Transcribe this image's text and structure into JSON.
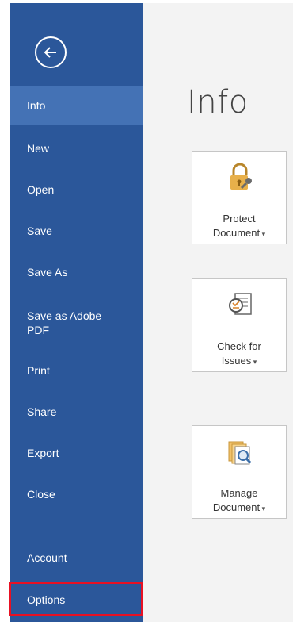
{
  "nav": {
    "items": [
      {
        "label": "Info",
        "active": true
      },
      {
        "label": "New"
      },
      {
        "label": "Open"
      },
      {
        "label": "Save"
      },
      {
        "label": "Save As"
      },
      {
        "label": "Save as Adobe\nPDF"
      },
      {
        "label": "Print"
      },
      {
        "label": "Share"
      },
      {
        "label": "Export"
      },
      {
        "label": "Close"
      },
      {
        "label": "Account"
      },
      {
        "label": "Options",
        "highlighted": true
      }
    ],
    "back_icon": "back-arrow-icon"
  },
  "main": {
    "title": "Info",
    "cards": [
      {
        "label": "Protect\nDocument",
        "icon": "lock-key-icon"
      },
      {
        "label": "Check for\nIssues",
        "icon": "inspect-document-icon"
      },
      {
        "label": "Manage\nDocument",
        "icon": "manage-document-icon"
      }
    ]
  },
  "colors": {
    "sidebar": "#2b579a",
    "active_item": "#4472b5",
    "highlight": "#e81123",
    "main_bg": "#f3f3f3"
  }
}
